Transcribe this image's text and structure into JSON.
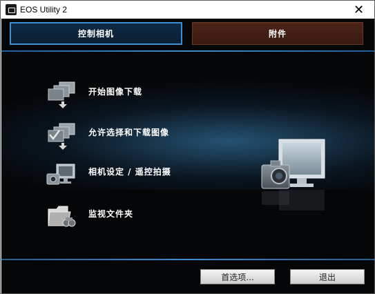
{
  "window": {
    "title": "EOS Utility 2",
    "close_glyph": "✕"
  },
  "tabs": [
    {
      "label": "控制相机",
      "active": true
    },
    {
      "label": "附件",
      "active": false
    }
  ],
  "menu": [
    {
      "label": "开始图像下载",
      "icon": "download-images-icon"
    },
    {
      "label": "允许选择和下载图像",
      "icon": "select-download-icon"
    },
    {
      "label": "相机设定 / 遥控拍摄",
      "icon": "camera-remote-icon"
    },
    {
      "label": "监视文件夹",
      "icon": "monitor-folder-icon"
    }
  ],
  "footer": {
    "preferences_label": "首选项...",
    "quit_label": "退出"
  },
  "colors": {
    "accent": "#3a8fd8",
    "background": "#050607",
    "tab_active": "#0f2a44",
    "tab_inactive": "#4a2418"
  }
}
